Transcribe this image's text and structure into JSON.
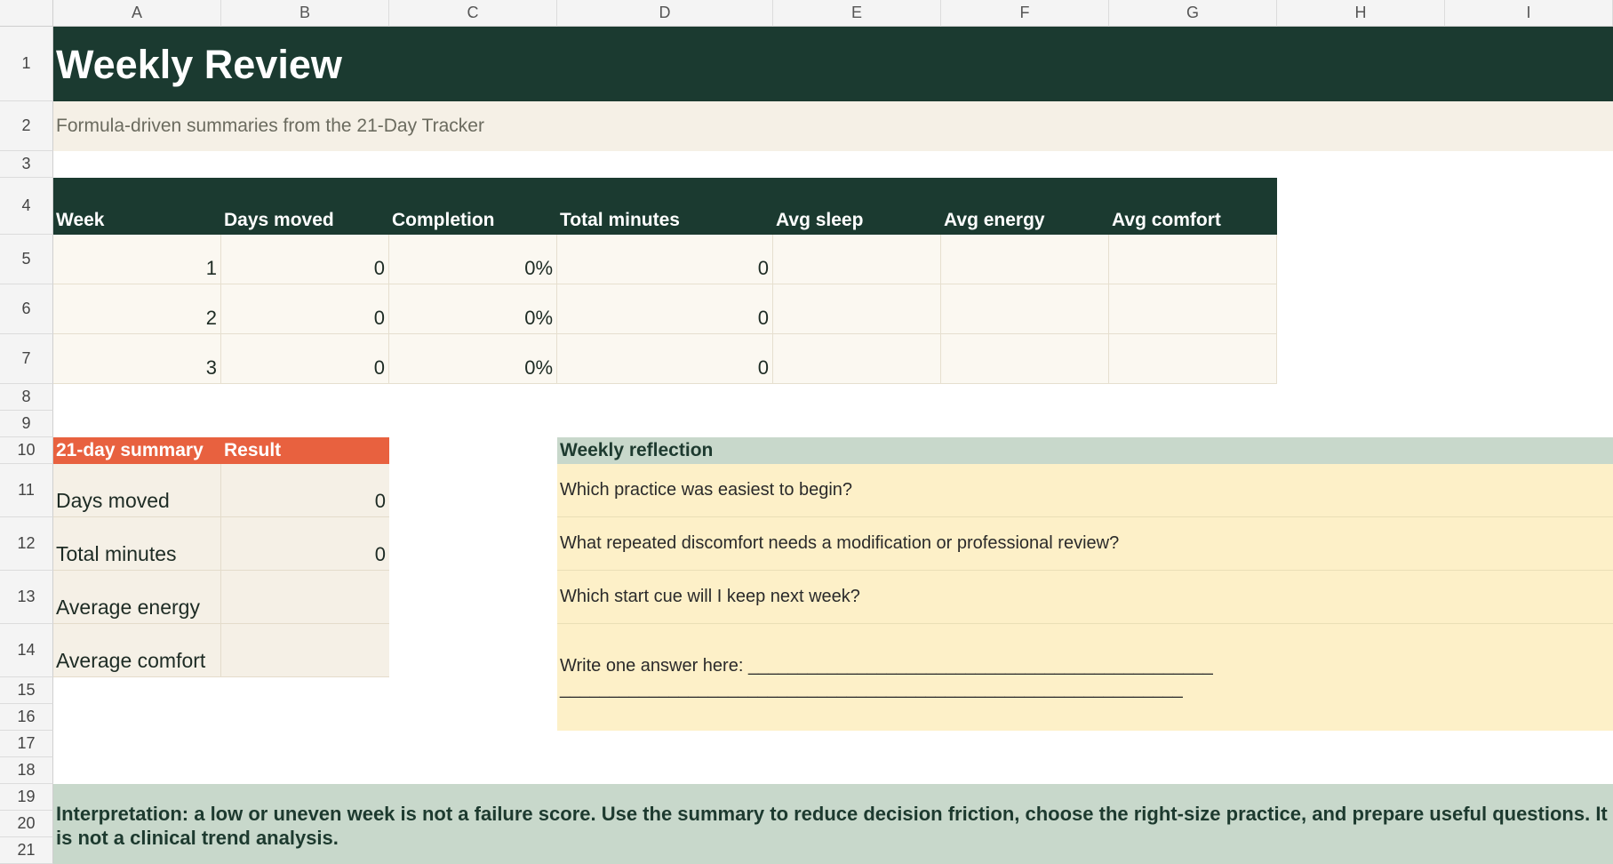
{
  "columns": [
    "A",
    "B",
    "C",
    "D",
    "E",
    "F",
    "G",
    "H",
    "I"
  ],
  "rows": [
    "1",
    "2",
    "3",
    "4",
    "5",
    "6",
    "7",
    "8",
    "9",
    "10",
    "11",
    "12",
    "13",
    "14",
    "15",
    "16",
    "17",
    "18",
    "19",
    "20",
    "21"
  ],
  "title": "Weekly Review",
  "subtitle": "Formula-driven summaries from the 21-Day Tracker",
  "weekly_table": {
    "headers": [
      "Week",
      "Days moved",
      "Completion",
      "Total minutes",
      "Avg sleep",
      "Avg energy",
      "Avg comfort"
    ],
    "rows": [
      [
        "1",
        "0",
        "0%",
        "0",
        "",
        "",
        ""
      ],
      [
        "2",
        "0",
        "0%",
        "0",
        "",
        "",
        ""
      ],
      [
        "3",
        "0",
        "0%",
        "0",
        "",
        "",
        ""
      ]
    ]
  },
  "summary": {
    "header_label": "21-day summary",
    "header_result": "Result",
    "rows": [
      {
        "label": "Days moved",
        "value": "0"
      },
      {
        "label": "Total minutes",
        "value": "0"
      },
      {
        "label": "Average energy",
        "value": ""
      },
      {
        "label": "Average comfort",
        "value": ""
      }
    ]
  },
  "reflection": {
    "header": "Weekly reflection",
    "questions": [
      "Which practice was easiest to begin?",
      "What repeated discomfort needs a modification or professional review?",
      "Which start cue will I keep next week?"
    ],
    "answer_prompt": "Write one answer here: _______________________________________________",
    "answer_line2": "_______________________________________________________________"
  },
  "interpretation": "Interpretation: a low or uneven week is not a failure score. Use the summary to reduce decision friction, choose the right-size practice, and prepare useful questions. It is not a clinical trend analysis.",
  "colors": {
    "dark_green": "#1b3a30",
    "cream": "#f5f0e6",
    "orange": "#e8613f",
    "sage": "#c8d8cb",
    "yellow": "#fdf0c8"
  }
}
